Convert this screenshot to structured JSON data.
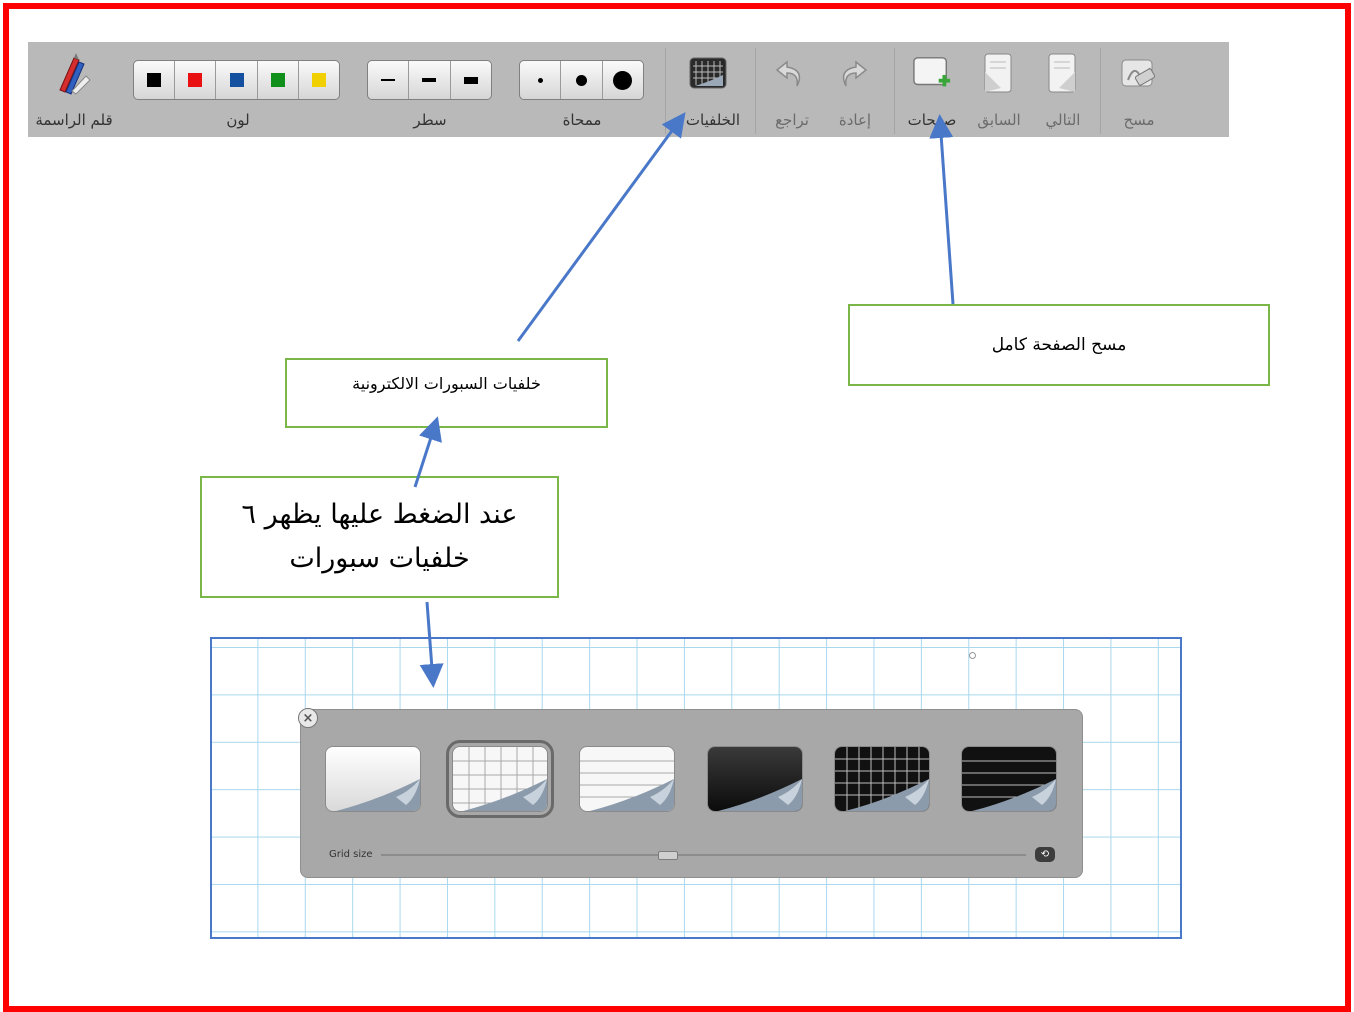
{
  "toolbar": {
    "pen": {
      "label": "قلم الراسمة",
      "icon": "pen-icon"
    },
    "color": {
      "label": "لون",
      "swatches": [
        "#000000",
        "#e81010",
        "#1450a0",
        "#10901a",
        "#f0d000"
      ]
    },
    "line": {
      "label": "سطر"
    },
    "eraser": {
      "label": "ممحاة"
    },
    "backgrounds": {
      "label": "الخلفيات",
      "icon": "background-icon"
    },
    "undo": {
      "label": "تراجع",
      "icon": "undo-icon"
    },
    "redo": {
      "label": "إعادة",
      "icon": "redo-icon"
    },
    "pages": {
      "label": "صفحات",
      "icon": "new-page-icon"
    },
    "prev": {
      "label": "السابق",
      "icon": "previous-page-icon"
    },
    "next": {
      "label": "التالي",
      "icon": "next-page-icon"
    },
    "clear": {
      "label": "مسح",
      "icon": "clear-icon"
    }
  },
  "callouts": {
    "clear_page": "مسح الصفحة كامل",
    "backgrounds": "خلفيات السبورات الالكترونية",
    "on_click_line1": "عند الضغط عليها يظهر ٦",
    "on_click_line2": "خلفيات سبورات"
  },
  "background_panel": {
    "grid_size_label": "Grid size",
    "options": [
      {
        "name": "white-plain"
      },
      {
        "name": "white-grid",
        "selected": true
      },
      {
        "name": "white-lined"
      },
      {
        "name": "black-plain"
      },
      {
        "name": "black-grid"
      },
      {
        "name": "black-lined"
      }
    ]
  },
  "colors": {
    "frame": "#ff0000",
    "callout_border": "#7ab648",
    "arrow": "#4a78c8",
    "toolbar_bg": "#b9b9b9"
  }
}
